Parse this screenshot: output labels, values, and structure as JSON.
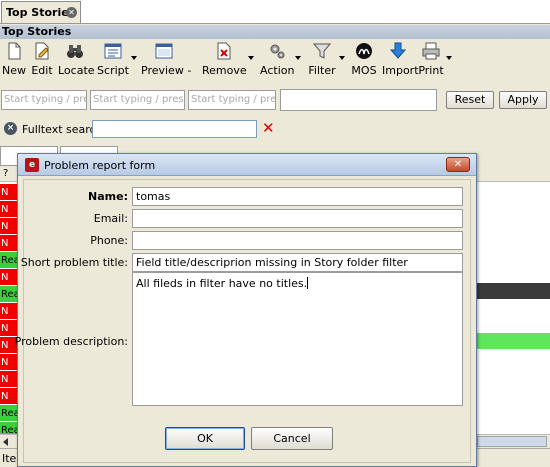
{
  "tab": {
    "label": "Top Stories"
  },
  "panel_title": "Top Stories",
  "toolbar": [
    {
      "label": "New",
      "icon": "new-document-icon"
    },
    {
      "label": "Edit",
      "icon": "edit-icon"
    },
    {
      "label": "Locate",
      "icon": "binoculars-icon"
    },
    {
      "label": "Script",
      "icon": "script-icon"
    },
    {
      "label": "Preview -",
      "icon": "preview-window-icon"
    },
    {
      "label": "Remove",
      "icon": "remove-document-icon"
    },
    {
      "label": "Action",
      "icon": "gears-icon"
    },
    {
      "label": "Filter",
      "icon": "funnel-icon"
    },
    {
      "label": "MOS",
      "icon": "mos-icon"
    },
    {
      "label": "Import",
      "icon": "import-arrow-icon"
    },
    {
      "label": "Print",
      "icon": "printer-icon"
    }
  ],
  "filters": {
    "placeholder_1": "Start typing / press",
    "placeholder_2": "Start typing / press F",
    "placeholder_3": "Start typing / press",
    "reset_label": "Reset",
    "apply_label": "Apply"
  },
  "fulltext": {
    "label": "Fulltext search:",
    "value": ""
  },
  "grid": {
    "header_cell": "?",
    "rows": [
      {
        "text": "N",
        "status": "red"
      },
      {
        "text": "N",
        "status": "red"
      },
      {
        "text": "N",
        "status": "red"
      },
      {
        "text": "N",
        "status": "red"
      },
      {
        "text": "Rea",
        "status": "green"
      },
      {
        "text": "N",
        "status": "red"
      },
      {
        "text": "Rea",
        "status": "green"
      },
      {
        "text": "N",
        "status": "red"
      },
      {
        "text": "N",
        "status": "red"
      },
      {
        "text": "N",
        "status": "red"
      },
      {
        "text": "N",
        "status": "red"
      },
      {
        "text": "N",
        "status": "red"
      },
      {
        "text": "N",
        "status": "red"
      },
      {
        "text": "Rea",
        "status": "green"
      },
      {
        "text": "Rea",
        "status": "green"
      },
      {
        "text": "Rea",
        "status": "green"
      }
    ]
  },
  "status_bar": {
    "text": "Iter"
  },
  "dialog": {
    "title": "Problem report form",
    "fields": {
      "name_label": "Name:",
      "name_value": "tomas",
      "email_label": "Email:",
      "email_value": "",
      "phone_label": "Phone:",
      "phone_value": "",
      "short_title_label": "Short problem title:",
      "short_title_value": "Field title/descriprion missing in Story folder filter",
      "description_label": "Problem description:",
      "description_value": "All fileds in filter have no titles."
    },
    "ok_label": "OK",
    "cancel_label": "Cancel"
  },
  "colors": {
    "status_new": "#f10000",
    "status_ready": "#3bd03b",
    "title_bar": "#b7c9e4"
  }
}
